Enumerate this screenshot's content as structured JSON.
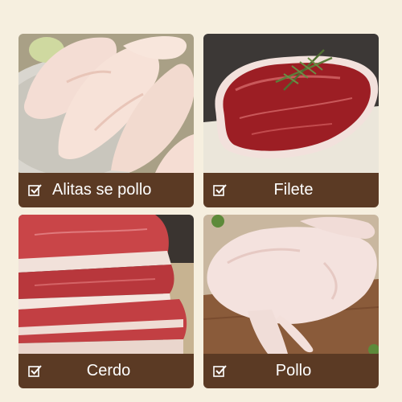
{
  "colors": {
    "background": "#f6efdf",
    "label_bar": "#5b3a24",
    "label_text": "#ffffff"
  },
  "cards": [
    {
      "label": "Alitas se pollo",
      "icon": "checkbox-checked-icon",
      "image": "raw-chicken-wings-photo"
    },
    {
      "label": "Filete",
      "icon": "checkbox-checked-icon",
      "image": "beef-steak-photo"
    },
    {
      "label": "Cerdo",
      "icon": "checkbox-checked-icon",
      "image": "pork-belly-photo"
    },
    {
      "label": "Pollo",
      "icon": "checkbox-checked-icon",
      "image": "whole-raw-chicken-photo"
    }
  ]
}
